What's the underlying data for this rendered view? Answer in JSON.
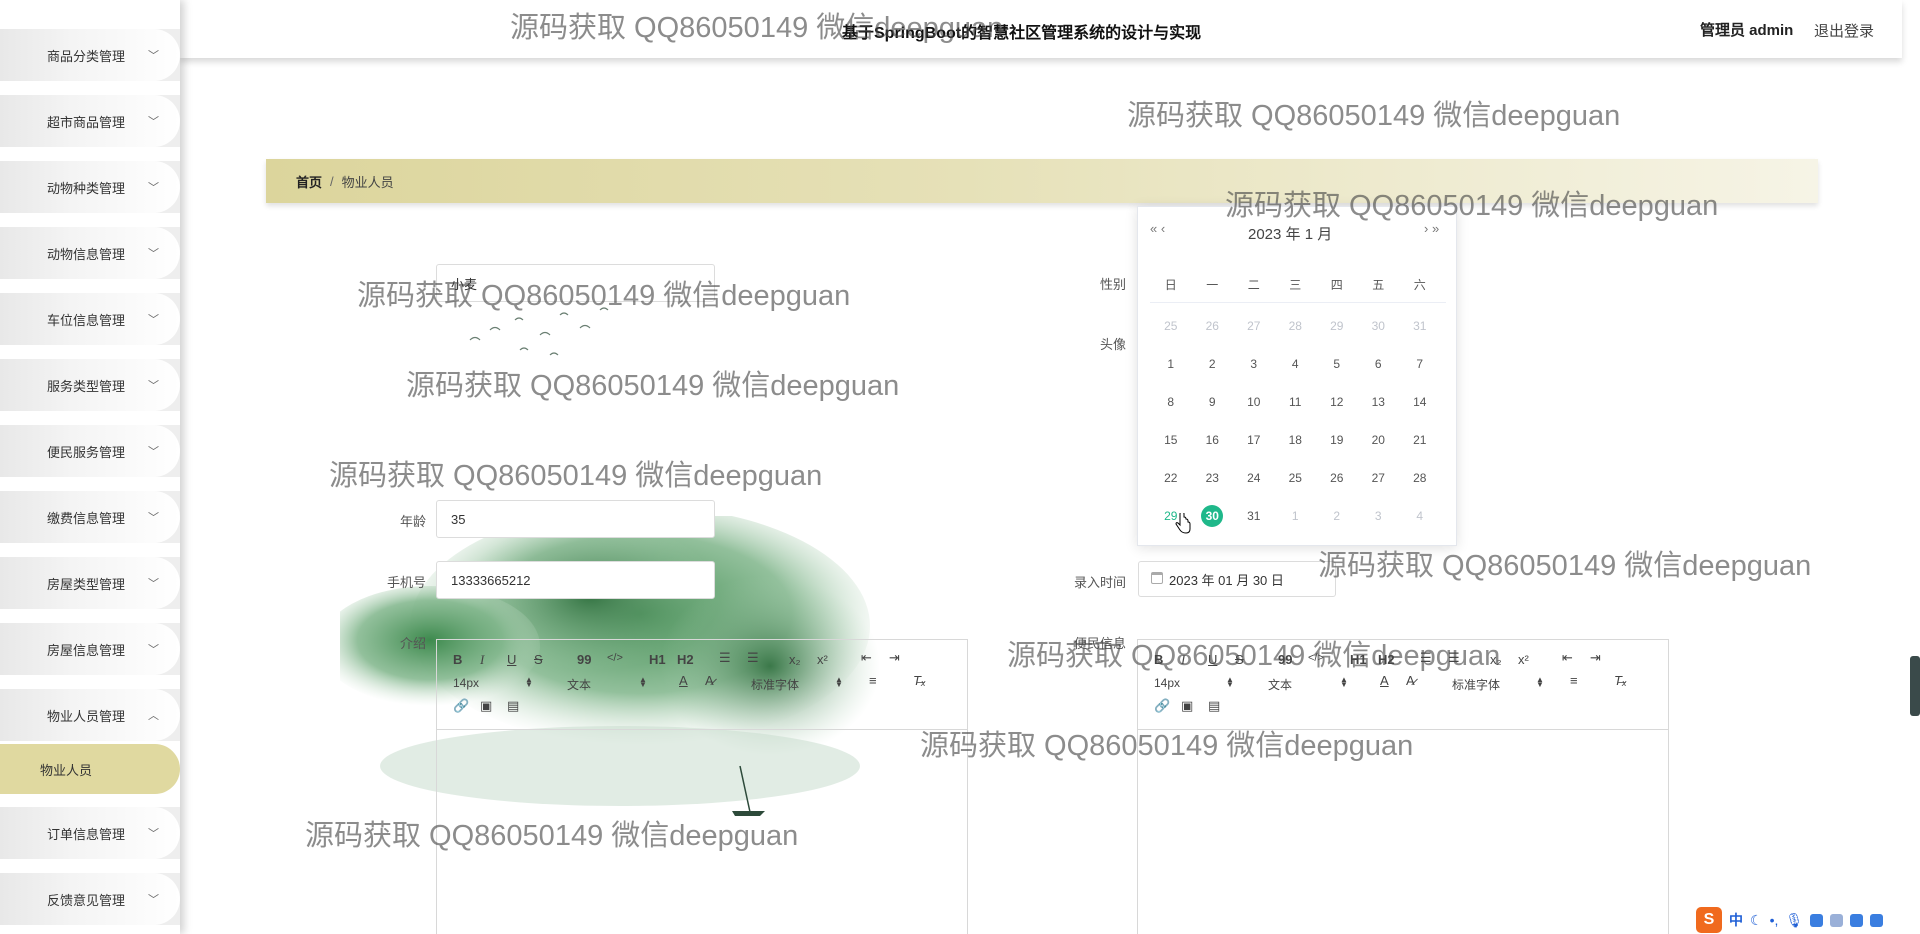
{
  "header": {
    "title": "基于SpringBoot的智慧社区管理系统的设计与实现",
    "user": "管理员 admin",
    "logout": "退出登录"
  },
  "sidebar": {
    "items": [
      {
        "label": "商品分类管理"
      },
      {
        "label": "超市商品管理"
      },
      {
        "label": "动物种类管理"
      },
      {
        "label": "动物信息管理"
      },
      {
        "label": "车位信息管理"
      },
      {
        "label": "服务类型管理"
      },
      {
        "label": "便民服务管理"
      },
      {
        "label": "缴费信息管理"
      },
      {
        "label": "房屋类型管理"
      },
      {
        "label": "房屋信息管理"
      },
      {
        "label": "物业人员管理"
      },
      {
        "label": "订单信息管理"
      },
      {
        "label": "反馈意见管理"
      }
    ],
    "submenu": {
      "label": "物业人员"
    },
    "expanded_item": "物业人员管理"
  },
  "breadcrumb": {
    "home": "首页",
    "separator": "/",
    "current": "物业人员"
  },
  "form": {
    "name_value": "小麦",
    "gender_label": "性别",
    "avatar_label": "头像",
    "age_label": "年龄",
    "age_value": "35",
    "phone_label": "手机号",
    "phone_value": "13333665212",
    "entry_time_label": "录入时间",
    "entry_time_value": "2023 年 01 月 30 日",
    "intro_label": "介绍",
    "other_label": "便民信息"
  },
  "editor": {
    "font_size": "14px",
    "text_type": "文本",
    "font_family": "标准字体",
    "buttons": [
      "B",
      "I",
      "U",
      "S",
      "99",
      "</>",
      "H1",
      "H2",
      "x₂",
      "x²"
    ]
  },
  "calendar": {
    "title": "2023 年  1 月",
    "nav_prev": "«  ‹",
    "nav_next": "›  »",
    "weekdays": [
      "日",
      "一",
      "二",
      "三",
      "四",
      "五",
      "六"
    ],
    "weeks": [
      [
        "25",
        "26",
        "27",
        "28",
        "29",
        "30",
        "31"
      ],
      [
        "1",
        "2",
        "3",
        "4",
        "5",
        "6",
        "7"
      ],
      [
        "8",
        "9",
        "10",
        "11",
        "12",
        "13",
        "14"
      ],
      [
        "15",
        "16",
        "17",
        "18",
        "19",
        "20",
        "21"
      ],
      [
        "22",
        "23",
        "24",
        "25",
        "26",
        "27",
        "28"
      ],
      [
        "29",
        "30",
        "31",
        "1",
        "2",
        "3",
        "4"
      ]
    ],
    "selected_day": "30"
  },
  "watermark": {
    "text": "源码获取 QQ86050149 微信deepguan"
  },
  "ime": {
    "logo": "S",
    "mode": "中"
  },
  "colors": {
    "accent": "#dcd59c",
    "today": "#1fb88a"
  }
}
